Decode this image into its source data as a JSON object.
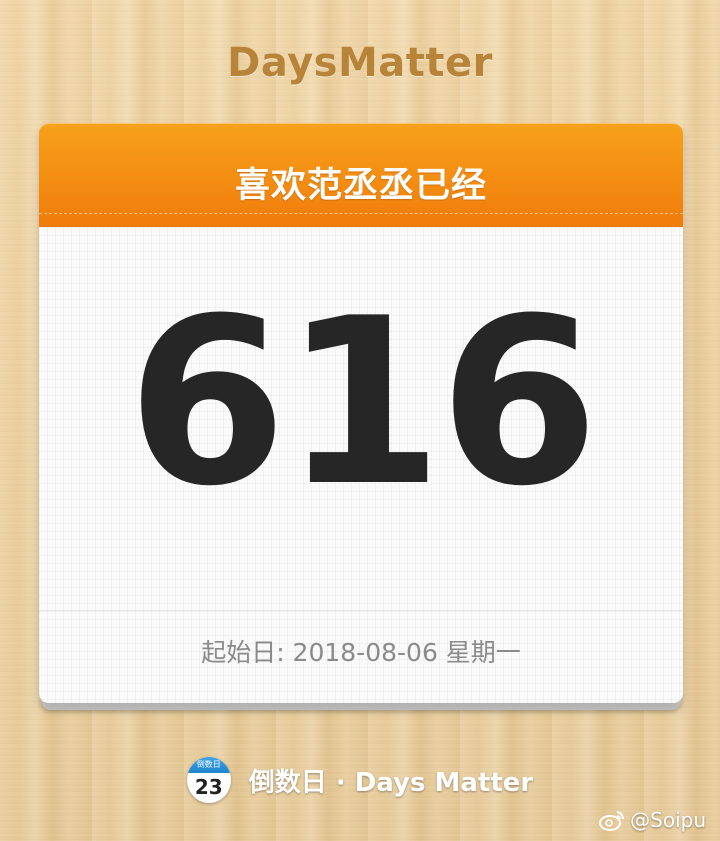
{
  "app": {
    "title": "DaysMatter"
  },
  "card": {
    "event_title": "喜欢范丞丞已经",
    "day_count": "616",
    "start_date": "起始日: 2018-08-06 星期一",
    "header_color": "#f48d12"
  },
  "footer": {
    "icon_top_text": "倒数日",
    "icon_day": "23",
    "label": "倒数日 · Days Matter"
  },
  "watermark": {
    "text": "@Soipu",
    "icon": "weibo-icon"
  }
}
